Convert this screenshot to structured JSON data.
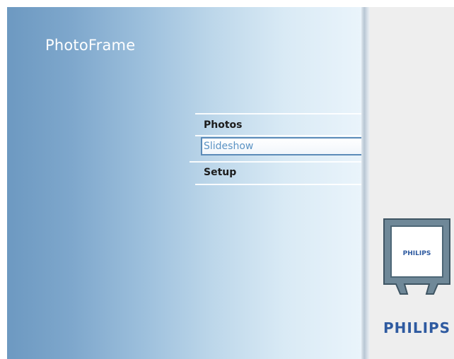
{
  "app": {
    "title": "PhotoFrame"
  },
  "menu": {
    "items": [
      {
        "label": "Photos",
        "selected": false
      },
      {
        "label": "Slideshow",
        "selected": true
      },
      {
        "label": "Setup",
        "selected": false
      }
    ]
  },
  "sidebar": {
    "device_icon": "photo-frame-device-icon",
    "device_logo_text": "PHILIPS",
    "brand_text": "PHILIPS"
  },
  "colors": {
    "brand_blue": "#2e5aa0",
    "selection_border": "#5b8bb8",
    "selection_text": "#5b93c4"
  }
}
